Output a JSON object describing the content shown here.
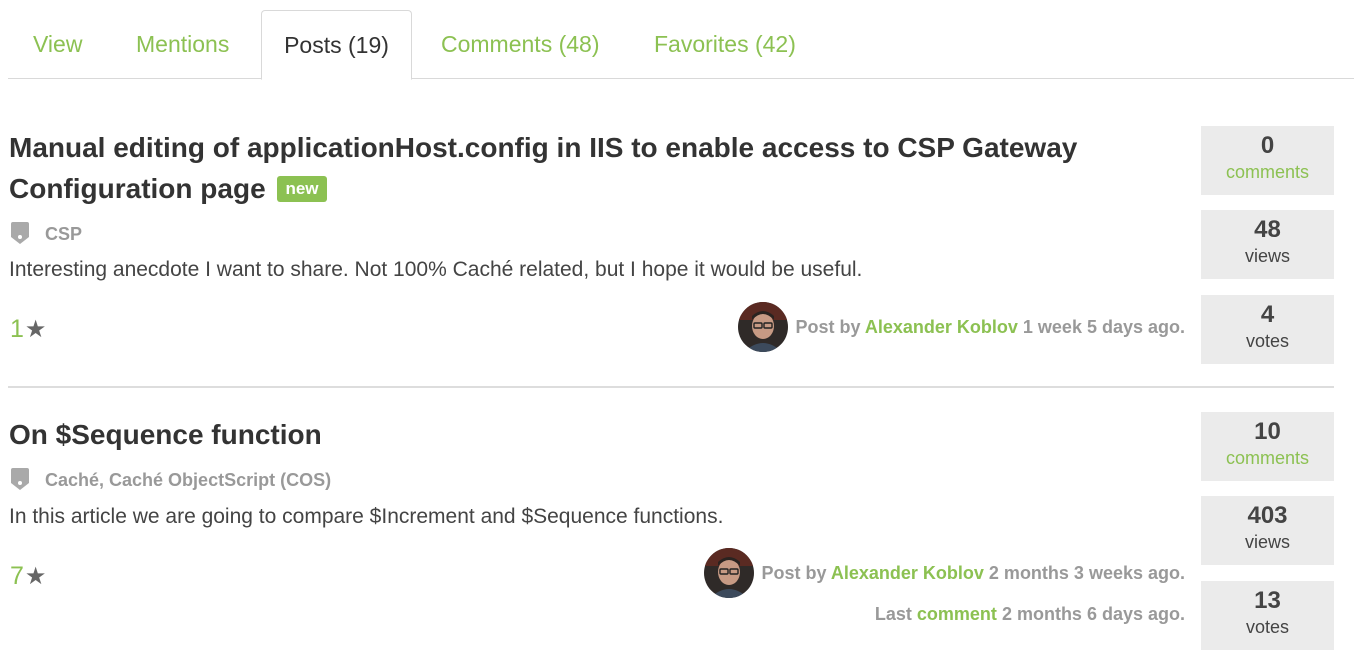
{
  "tabs": {
    "view": "View",
    "mentions": "Mentions",
    "posts": "Posts (19)",
    "comments": "Comments (48)",
    "favorites": "Favorites (42)"
  },
  "colors": {
    "accent": "#8cc152",
    "stat_bg": "#ebebeb",
    "muted": "#999999"
  },
  "posts": [
    {
      "title": "Manual editing of applicationHost.config in IIS to enable access to CSP Gateway Configuration page",
      "badge": "new",
      "tags": "CSP",
      "excerpt": "Interesting anecdote I want to share. Not 100% Caché related, but I hope it would be useful.",
      "favorites": "1",
      "byline_prefix": "Post by",
      "author": "Alexander Koblov",
      "posted_ago": "1 week 5 days ago.",
      "comments_count": "0",
      "comments_label": "comments",
      "views_count": "48",
      "views_label": "views",
      "votes_count": "4",
      "votes_label": "votes"
    },
    {
      "title": "On $Sequence function",
      "tags": "Caché, Caché ObjectScript (COS)",
      "excerpt": "In this article we are going to compare $Increment and $Sequence functions.",
      "favorites": "7",
      "byline_prefix": "Post by",
      "author": "Alexander Koblov",
      "posted_ago": "2 months 3 weeks ago.",
      "last_prefix": "Last",
      "last_link": "comment",
      "last_ago": "2 months 6 days ago.",
      "comments_count": "10",
      "comments_label": "comments",
      "views_count": "403",
      "views_label": "views",
      "votes_count": "13",
      "votes_label": "votes"
    }
  ]
}
